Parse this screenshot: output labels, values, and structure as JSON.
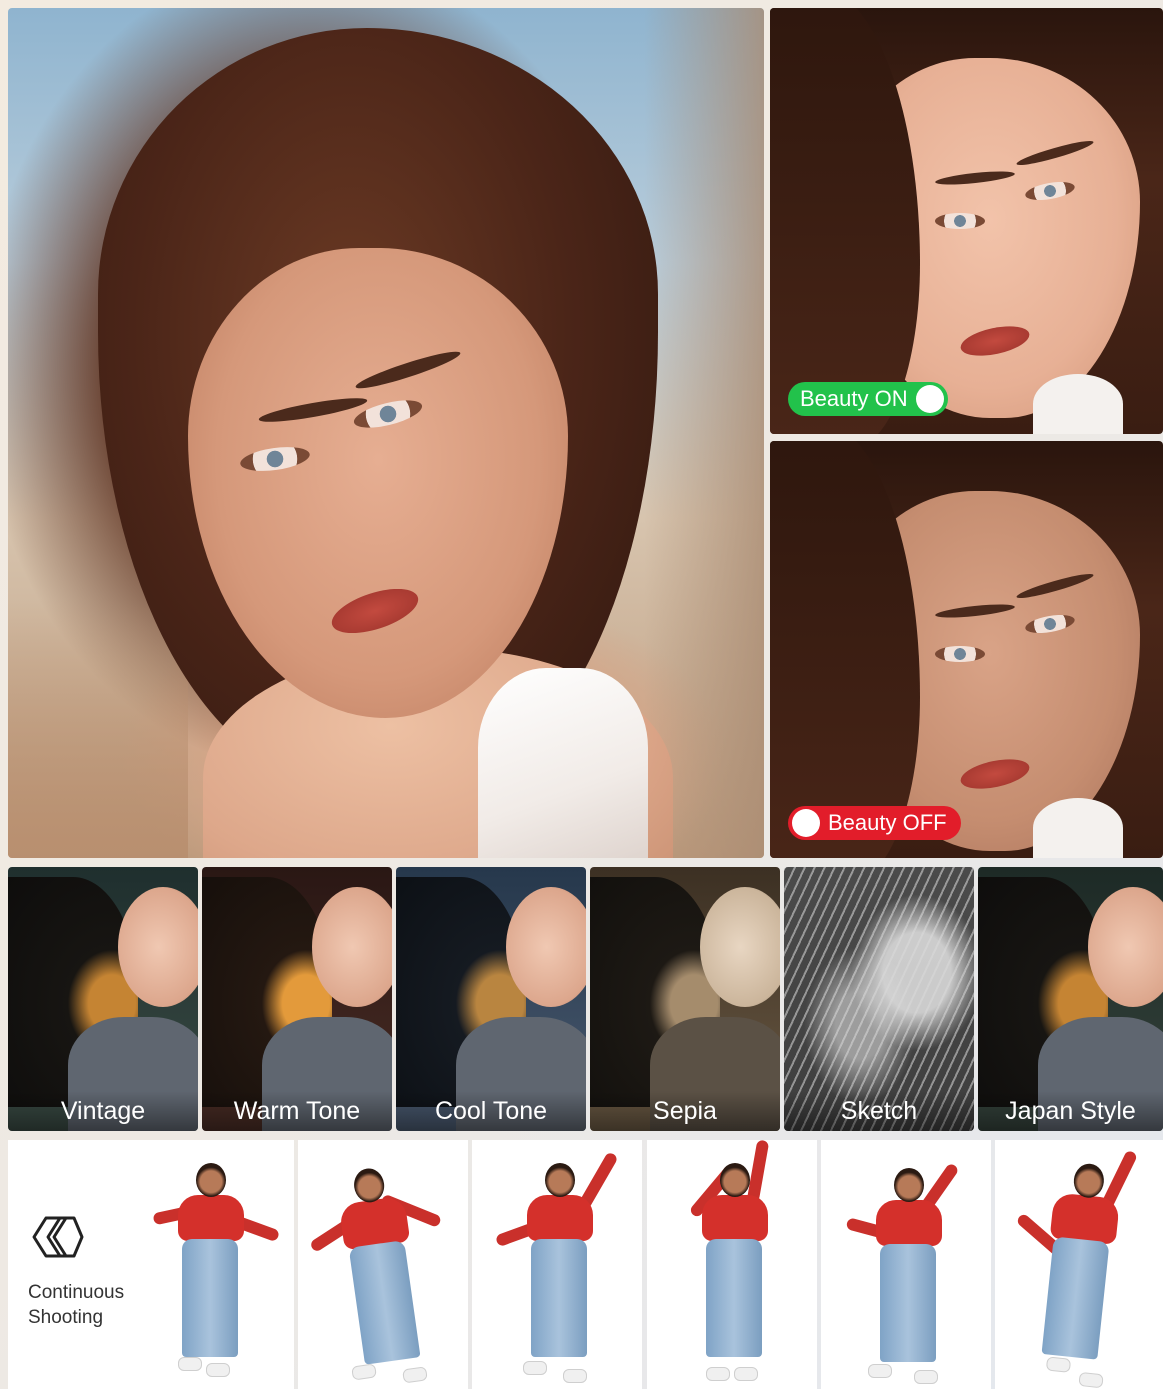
{
  "comparison": {
    "beauty_on_label": "Beauty ON",
    "beauty_off_label": "Beauty OFF",
    "on_color": "#22c24b",
    "off_color": "#e21d2a"
  },
  "filters": [
    {
      "label": "Vintage"
    },
    {
      "label": "Warm Tone"
    },
    {
      "label": "Cool Tone"
    },
    {
      "label": "Sepia"
    },
    {
      "label": "Sketch"
    },
    {
      "label": "Japan Style"
    }
  ],
  "continuous_shooting": {
    "icon": "layered-frames-icon",
    "label_line1": "Continuous",
    "label_line2": "Shooting"
  }
}
